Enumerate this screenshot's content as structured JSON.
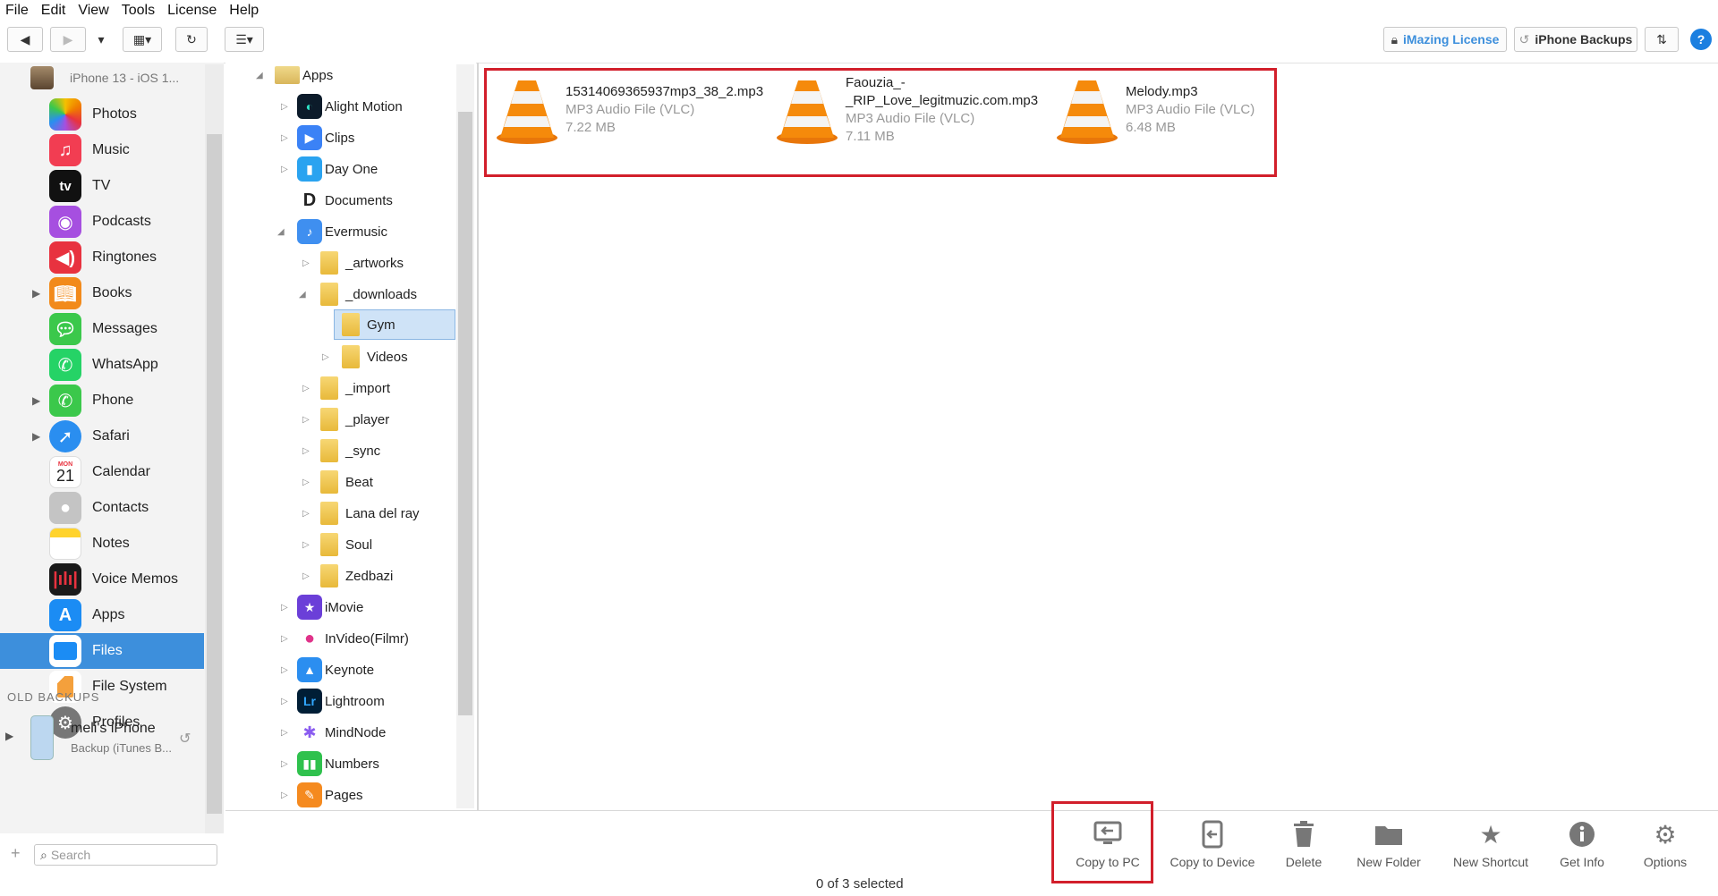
{
  "menu": [
    "File",
    "Edit",
    "View",
    "Tools",
    "License",
    "Help"
  ],
  "toolbar": {
    "license_label": "iMazing License",
    "backups_label": "iPhone Backups",
    "help_label": "?"
  },
  "device": {
    "name": "iPhone 13 - iOS 1..."
  },
  "sidebar": {
    "items": [
      {
        "label": "Photos",
        "color": "#ffffff"
      },
      {
        "label": "Music",
        "color": "#f23d52"
      },
      {
        "label": "TV",
        "color": "#111111"
      },
      {
        "label": "Podcasts",
        "color": "#a64fe0"
      },
      {
        "label": "Ringtones",
        "color": "#e8323f"
      },
      {
        "label": "Books",
        "color": "#f28a1b"
      },
      {
        "label": "Messages",
        "color": "#3bc84b"
      },
      {
        "label": "WhatsApp",
        "color": "#25d366"
      },
      {
        "label": "Phone",
        "color": "#3bc84b"
      },
      {
        "label": "Safari",
        "color": "#2a8ef0"
      },
      {
        "label": "Calendar",
        "color": "#ffffff"
      },
      {
        "label": "Contacts",
        "color": "#bdbdbd"
      },
      {
        "label": "Notes",
        "color": "#ffd32c"
      },
      {
        "label": "Voice Memos",
        "color": "#1a1a1a"
      },
      {
        "label": "Apps",
        "color": "#1b8cf4"
      },
      {
        "label": "Files",
        "color": "#1b8cf4"
      },
      {
        "label": "File System",
        "color": "#ffffff"
      },
      {
        "label": "Profiles",
        "color": "#777777"
      }
    ],
    "calendar_day": "MON",
    "calendar_date": "21",
    "tv_label": "tv",
    "old_backups": "OLD BACKUPS",
    "backup_name": "meli's iPhone",
    "backup_sub": "Backup (iTunes B...",
    "search_placeholder": "Search"
  },
  "tree": {
    "items": [
      {
        "label": "Apps"
      },
      {
        "label": "Alight Motion"
      },
      {
        "label": "Clips"
      },
      {
        "label": "Day One"
      },
      {
        "label": "Documents"
      },
      {
        "label": "Evermusic"
      },
      {
        "label": "_artworks"
      },
      {
        "label": "_downloads"
      },
      {
        "label": "Gym"
      },
      {
        "label": "Videos"
      },
      {
        "label": "_import"
      },
      {
        "label": "_player"
      },
      {
        "label": "_sync"
      },
      {
        "label": "Beat"
      },
      {
        "label": "Lana del ray"
      },
      {
        "label": "Soul"
      },
      {
        "label": "Zedbazi"
      },
      {
        "label": "iMovie"
      },
      {
        "label": "InVideo(Filmr)"
      },
      {
        "label": "Keynote"
      },
      {
        "label": "Lightroom"
      },
      {
        "label": "MindNode"
      },
      {
        "label": "Numbers"
      },
      {
        "label": "Pages"
      }
    ]
  },
  "files": [
    {
      "name": "15314069365937mp3_38_2.mp3",
      "name2": "",
      "type": "MP3 Audio File (VLC)",
      "size": "7.22 MB"
    },
    {
      "name": "Faouzia_-",
      "name2": "_RIP_Love_legitmuzic.com.mp3",
      "type": "MP3 Audio File (VLC)",
      "size": "7.11 MB"
    },
    {
      "name": "Melody.mp3",
      "name2": "",
      "type": "MP3 Audio File (VLC)",
      "size": "6.48 MB"
    }
  ],
  "actions": [
    {
      "label": "Copy to PC"
    },
    {
      "label": "Copy to Device"
    },
    {
      "label": "Delete"
    },
    {
      "label": "New Folder"
    },
    {
      "label": "New Shortcut"
    },
    {
      "label": "Get Info"
    },
    {
      "label": "Options"
    }
  ],
  "status": "0 of 3 selected",
  "colors": {
    "accent": "#3d8fdc",
    "highlight": "#d21f2b"
  }
}
